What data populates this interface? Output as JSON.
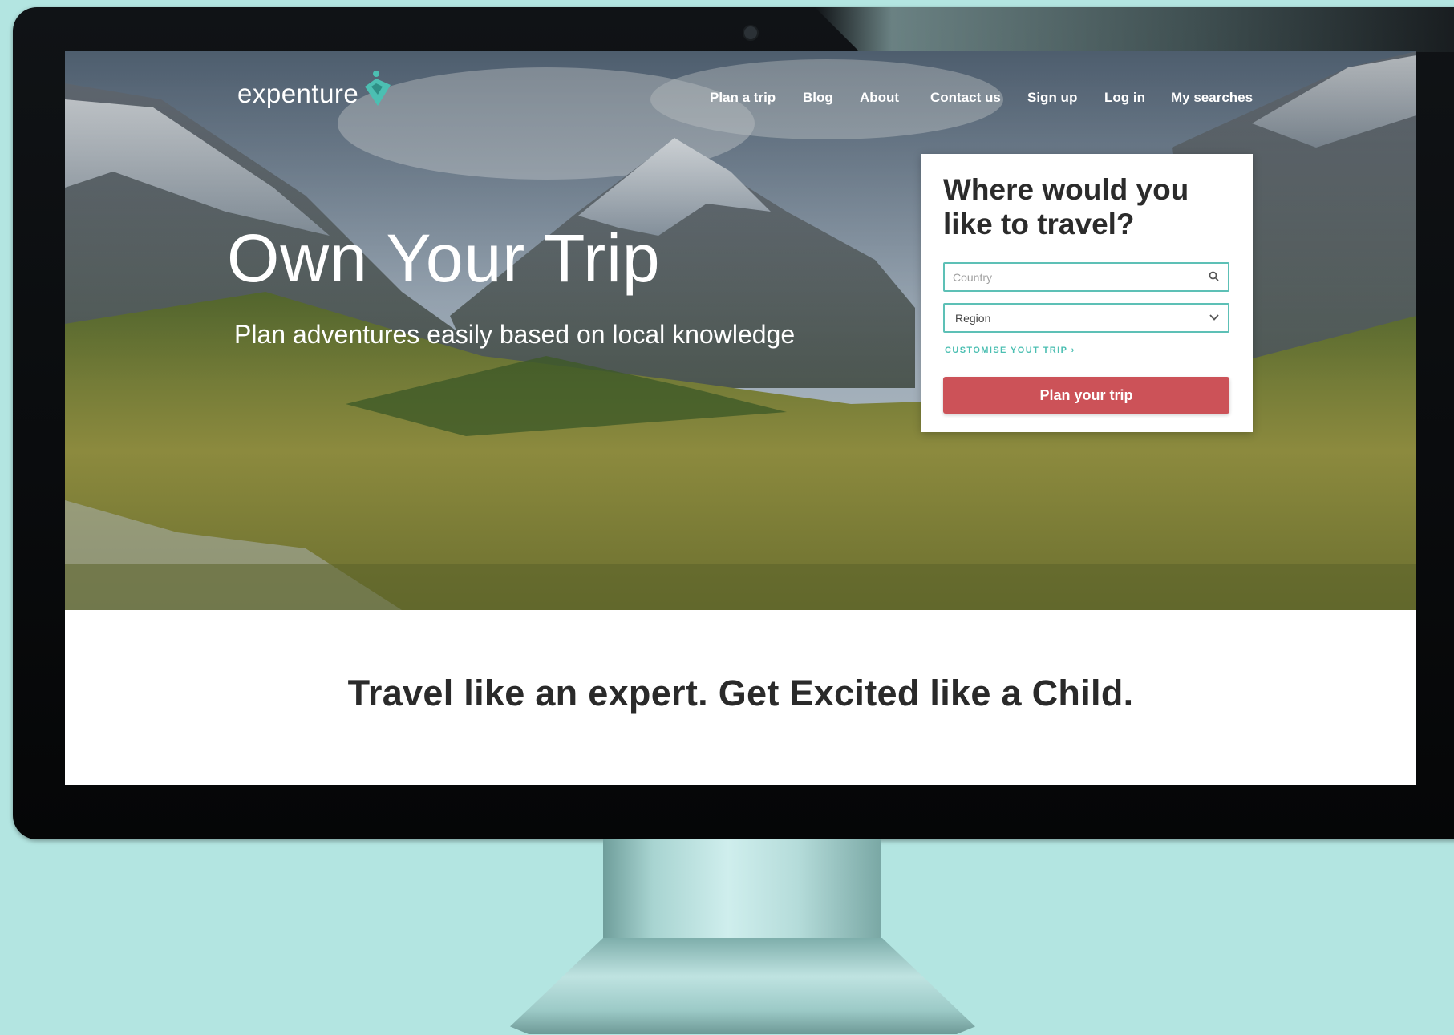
{
  "brand": {
    "name": "expenture",
    "accent": "#4cbfb2"
  },
  "nav": {
    "items": [
      {
        "label": "Plan a trip"
      },
      {
        "label": "Blog"
      },
      {
        "label": "About"
      },
      {
        "label": "Contact us"
      },
      {
        "label": "Sign up"
      },
      {
        "label": "Log in"
      },
      {
        "label": "My searches"
      }
    ]
  },
  "hero": {
    "headline": "Own Your Trip",
    "subheadline": "Plan adventures easily based on local knowledge"
  },
  "search_card": {
    "title": "Where would you like to travel?",
    "country_placeholder": "Country",
    "region_value": "Region",
    "customise_link": "CUSTOMISE YOUT TRIP ›",
    "submit_label": "Plan your trip",
    "button_color": "#cc5258"
  },
  "tagline": "Travel like an expert. Get Excited like a Child.",
  "icons": [
    "logo-pin-icon",
    "search-icon",
    "chevron-down-icon"
  ]
}
